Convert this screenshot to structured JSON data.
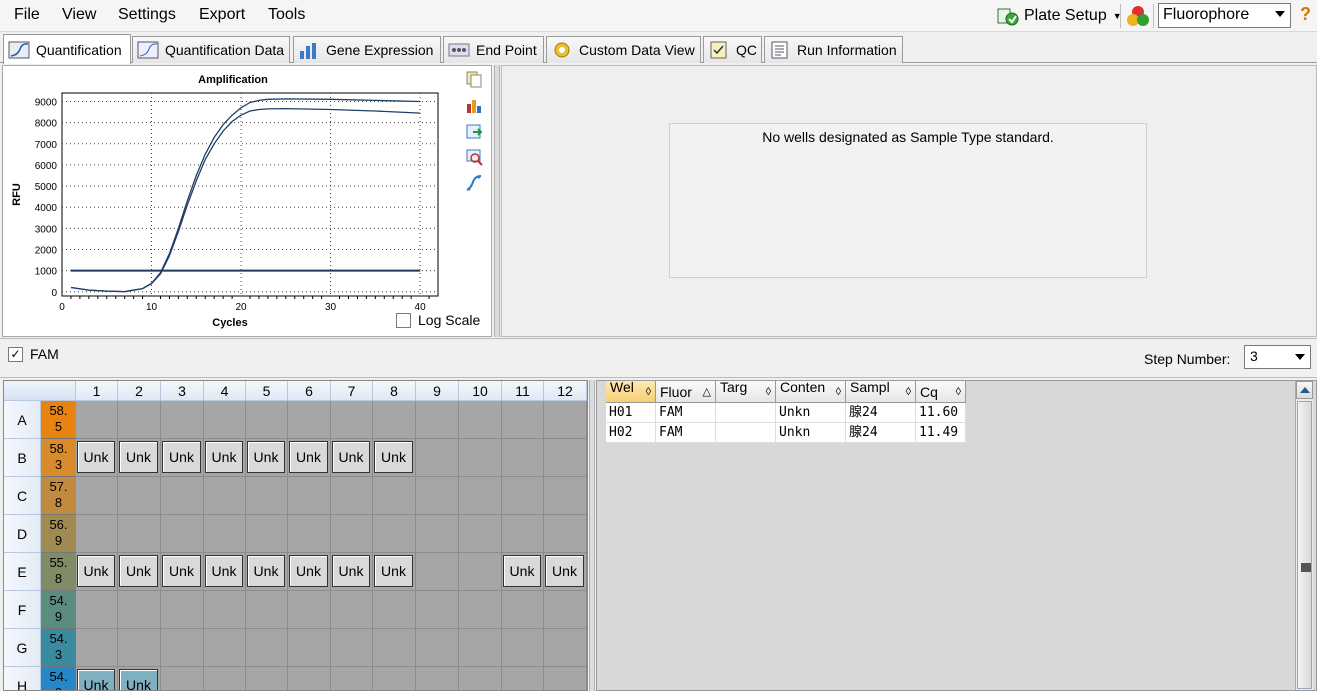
{
  "menu": [
    "File",
    "View",
    "Settings",
    "Export",
    "Tools"
  ],
  "toolbar": {
    "plate_setup": "Plate Setup",
    "fluorophore": "Fluorophore",
    "help": "?"
  },
  "tabs": [
    "Quantification",
    "Quantification Data",
    "Gene Expression",
    "End Point",
    "Custom Data View",
    "QC",
    "Run Information"
  ],
  "chart": {
    "title": "Amplification",
    "xlabel": "Cycles",
    "ylabel": "RFU",
    "log_scale_label": "Log Scale",
    "log_scale_checked": false
  },
  "chart_data": {
    "type": "line",
    "title": "Amplification",
    "xlabel": "Cycles",
    "ylabel": "RFU",
    "xlim": [
      0,
      42
    ],
    "ylim": [
      -200,
      9400
    ],
    "xticks": [
      0,
      10,
      20,
      30,
      40
    ],
    "yticks": [
      0,
      1000,
      2000,
      3000,
      4000,
      5000,
      6000,
      7000,
      8000,
      9000
    ],
    "grid": true,
    "series": [
      {
        "x": [
          1,
          3,
          5,
          7,
          9,
          10,
          11,
          12,
          13,
          14,
          15,
          16,
          17,
          18,
          19,
          20,
          21,
          22,
          23,
          25,
          30,
          35,
          40
        ],
        "values": [
          200,
          80,
          30,
          10,
          150,
          400,
          900,
          1800,
          3000,
          4300,
          5500,
          6500,
          7300,
          7900,
          8350,
          8700,
          8950,
          9050,
          9100,
          9120,
          9100,
          9050,
          9000
        ]
      },
      {
        "x": [
          1,
          3,
          5,
          7,
          9,
          10,
          11,
          12,
          13,
          14,
          15,
          16,
          17,
          18,
          19,
          20,
          21,
          22,
          23,
          25,
          30,
          35,
          40
        ],
        "values": [
          200,
          80,
          30,
          10,
          150,
          380,
          850,
          1700,
          2850,
          4100,
          5250,
          6250,
          7000,
          7600,
          8050,
          8350,
          8550,
          8620,
          8650,
          8660,
          8620,
          8550,
          8450
        ]
      },
      {
        "x": [
          1,
          40
        ],
        "values": [
          1000,
          1000
        ]
      }
    ]
  },
  "std_message": "No wells designated as Sample Type standard.",
  "filter": {
    "fam_label": "FAM",
    "fam_checked": true,
    "step_label": "Step Number:",
    "step_value": "3"
  },
  "plate": {
    "columns": [
      "1",
      "2",
      "3",
      "4",
      "5",
      "6",
      "7",
      "8",
      "9",
      "10",
      "11",
      "12"
    ],
    "rows": [
      {
        "label": "A",
        "temp": "58.\n5",
        "temp_color": "#e8830f",
        "wells": [
          "",
          "",
          "",
          "",
          "",
          "",
          "",
          "",
          "",
          "",
          "",
          ""
        ]
      },
      {
        "label": "B",
        "temp": "58.\n3",
        "temp_color": "#d98a2a",
        "wells": [
          "Unk",
          "Unk",
          "Unk",
          "Unk",
          "Unk",
          "Unk",
          "Unk",
          "Unk",
          "",
          "",
          "",
          ""
        ]
      },
      {
        "label": "C",
        "temp": "57.\n8",
        "temp_color": "#c18a3e",
        "wells": [
          "",
          "",
          "",
          "",
          "",
          "",
          "",
          "",
          "",
          "",
          "",
          ""
        ]
      },
      {
        "label": "D",
        "temp": "56.\n9",
        "temp_color": "#a08a52",
        "wells": [
          "",
          "",
          "",
          "",
          "",
          "",
          "",
          "",
          "",
          "",
          "",
          ""
        ]
      },
      {
        "label": "E",
        "temp": "55.\n8",
        "temp_color": "#7f8c66",
        "wells": [
          "Unk",
          "Unk",
          "Unk",
          "Unk",
          "Unk",
          "Unk",
          "Unk",
          "Unk",
          "",
          "",
          "Unk",
          "Unk"
        ]
      },
      {
        "label": "F",
        "temp": "54.\n9",
        "temp_color": "#5a8d80",
        "wells": [
          "",
          "",
          "",
          "",
          "",
          "",
          "",
          "",
          "",
          "",
          "",
          ""
        ]
      },
      {
        "label": "G",
        "temp": "54.\n3",
        "temp_color": "#3a8aa0",
        "wells": [
          "",
          "",
          "",
          "",
          "",
          "",
          "",
          "",
          "",
          "",
          "",
          ""
        ]
      },
      {
        "label": "H",
        "temp": "54.\n0",
        "temp_color": "#2586c8",
        "wells": [
          "Unk",
          "Unk",
          "",
          "",
          "",
          "",
          "",
          "",
          "",
          "",
          "",
          ""
        ]
      }
    ]
  },
  "results": {
    "columns": [
      "Wel\nl",
      "Fluor",
      "Targ\net",
      "Conten\nt",
      "Sampl\ne",
      "Cq"
    ],
    "rows": [
      [
        "H01",
        "FAM",
        "",
        "Unkn",
        "腺24",
        "11.60"
      ],
      [
        "H02",
        "FAM",
        "",
        "Unkn",
        "腺24",
        "11.49"
      ]
    ]
  },
  "colors": {
    "curve": "#1f3f66",
    "threshold": "#1b3a5c",
    "plate_bg": "#a6a6a6"
  }
}
